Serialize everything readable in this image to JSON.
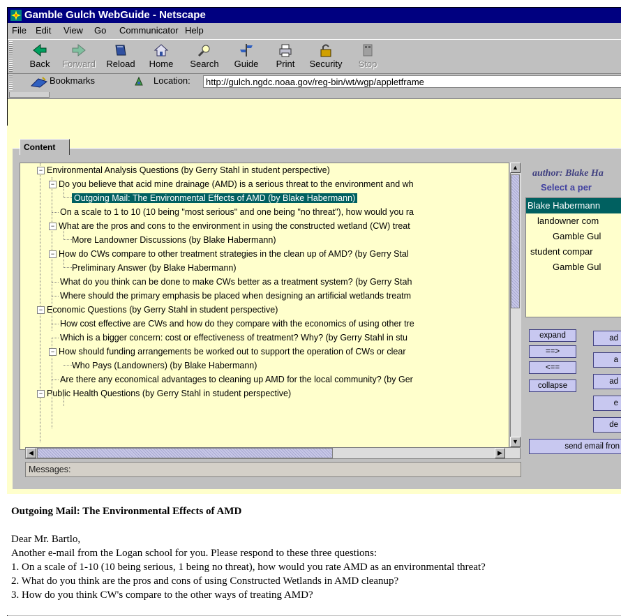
{
  "window": {
    "title": "Gamble Gulch WebGuide - Netscape"
  },
  "menu": {
    "items": [
      "File",
      "Edit",
      "View",
      "Go",
      "Communicator",
      "Help"
    ]
  },
  "toolbar": {
    "buttons": [
      {
        "label": "Back",
        "icon": "back-arrow-icon",
        "enabled": true
      },
      {
        "label": "Forward",
        "icon": "forward-arrow-icon",
        "enabled": false
      },
      {
        "label": "Reload",
        "icon": "reload-icon",
        "enabled": true
      },
      {
        "label": "Home",
        "icon": "home-icon",
        "enabled": true
      },
      {
        "label": "Search",
        "icon": "search-icon",
        "enabled": true
      },
      {
        "label": "Guide",
        "icon": "guide-icon",
        "enabled": true
      },
      {
        "label": "Print",
        "icon": "print-icon",
        "enabled": true
      },
      {
        "label": "Security",
        "icon": "security-lock-icon",
        "enabled": true
      },
      {
        "label": "Stop",
        "icon": "stop-icon",
        "enabled": false
      }
    ]
  },
  "location": {
    "bookmarks_label": "Bookmarks",
    "location_label": "Location:",
    "url": "http://gulch.ngdc.noaa.gov/reg-bin/wt/wgp/appletframe"
  },
  "applet": {
    "tab_label": "Content",
    "tree": [
      {
        "text": "Environmental Analysis Questions  (by Gerry Stahl in student perspective)",
        "expander": "minus"
      },
      {
        "text": "Do you believe that acid mine drainage (AMD) is a serious threat to the environment and wh",
        "expander": "minus"
      },
      {
        "text": "Outgoing Mail: The Environmental Effects of AMD  (by Blake Habermann)",
        "selected": true
      },
      {
        "text": "On a scale to 1 to 10 (10 being \"most serious\" and one being \"no threat\"), how would you ra"
      },
      {
        "text": "What are the pros and cons to the environment in using the constructed wetland (CW) treat",
        "expander": "minus"
      },
      {
        "text": "More Landowner Discussions  (by Blake Habermann)"
      },
      {
        "text": "How do CWs compare to other treatment strategies in the clean up of AMD?  (by Gerry Stal",
        "expander": "minus"
      },
      {
        "text": "Preliminary Answer  (by Blake Habermann)"
      },
      {
        "text": "What do you think can be done to make CWs better as a treatment system?  (by Gerry Stah"
      },
      {
        "text": "Where should the primary emphasis be placed when designing an artificial wetlands treatm"
      },
      {
        "text": "Economic Questions  (by Gerry Stahl in student perspective)",
        "expander": "minus"
      },
      {
        "text": "How cost effective are CWs and how do they compare with the economics of using other tre"
      },
      {
        "text": "Which is a bigger concern:  cost or effectiveness of treatment?  Why?  (by Gerry Stahl in stu"
      },
      {
        "text": "How should funding arrangements be worked out to support the operation of  CWs or clear",
        "expander": "minus"
      },
      {
        "text": "Who Pays (Landowners)  (by Blake Habermann)"
      },
      {
        "text": "Are there any economical advantages to cleaning up AMD for the local community?  (by Ger"
      },
      {
        "text": "Public Health Questions  (by Gerry Stahl in student perspective)",
        "expander": "minus"
      }
    ],
    "messages_label": "Messages:",
    "author_label": "author: Blake Ha",
    "select_label": "Select a per",
    "perspectives": [
      {
        "text": "Blake Habermann",
        "selected": true
      },
      {
        "text": "landowner com"
      },
      {
        "text": "Gamble Gul"
      },
      {
        "text": "student compar"
      },
      {
        "text": "Gamble Gul"
      }
    ],
    "nav_buttons": [
      "expand",
      "==>",
      "<==",
      "collapse"
    ],
    "action_buttons": [
      "ad",
      "a",
      "ad",
      "e",
      "de"
    ],
    "send_email": "send email fron"
  },
  "document": {
    "title": "Outgoing Mail: The Environmental Effects of AMD",
    "greeting": "Dear Mr. Bartlo,",
    "lines": [
      "Another e-mail from the Logan school for you. Please respond to these three questions:",
      "1. On a scale of 1-10 (10 being serious, 1 being no threat), how would you rate AMD as an environmental threat?",
      "2. What do you think are the pros and cons of using Constructed Wetlands in AMD cleanup?",
      "3. How do you think CW's compare to the other ways of treating AMD?"
    ]
  }
}
